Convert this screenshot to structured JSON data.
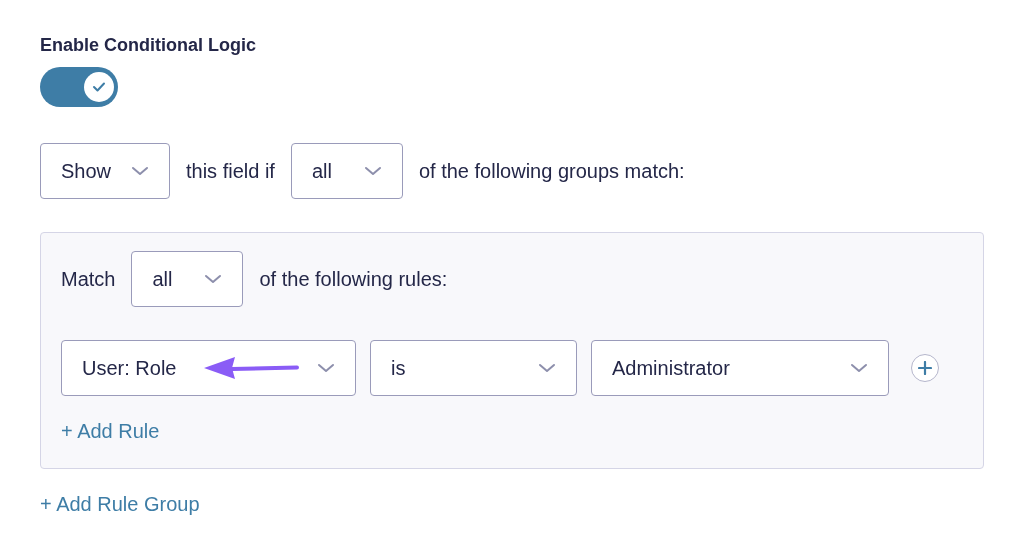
{
  "toggle": {
    "label": "Enable Conditional Logic",
    "on": true
  },
  "condition": {
    "action": "Show",
    "text_before": "this field if",
    "logic": "all",
    "text_after": "of the following groups match:"
  },
  "rule_group": {
    "match_label": "Match",
    "match": "all",
    "match_suffix": "of the following rules:",
    "rules": [
      {
        "field": "User: Role",
        "operator": "is",
        "value": "Administrator"
      }
    ],
    "add_rule": "+ Add Rule"
  },
  "add_rule_group": "+ Add Rule Group"
}
